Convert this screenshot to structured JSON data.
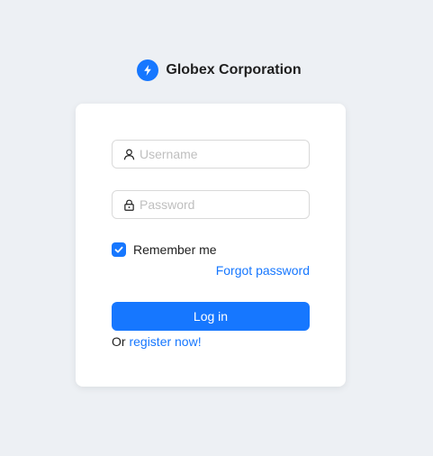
{
  "brand": {
    "name": "Globex Corporation",
    "logo_icon": "lightning-bolt-icon",
    "accent_color": "#1677ff"
  },
  "login_form": {
    "username": {
      "value": "",
      "placeholder": "Username",
      "icon": "user-icon"
    },
    "password": {
      "value": "",
      "placeholder": "Password",
      "icon": "lock-icon"
    },
    "remember_me": {
      "label": "Remember me",
      "checked": true
    },
    "forgot_password_label": "Forgot password",
    "submit_label": "Log in",
    "register_prefix": "Or",
    "register_link_label": "register now!"
  }
}
